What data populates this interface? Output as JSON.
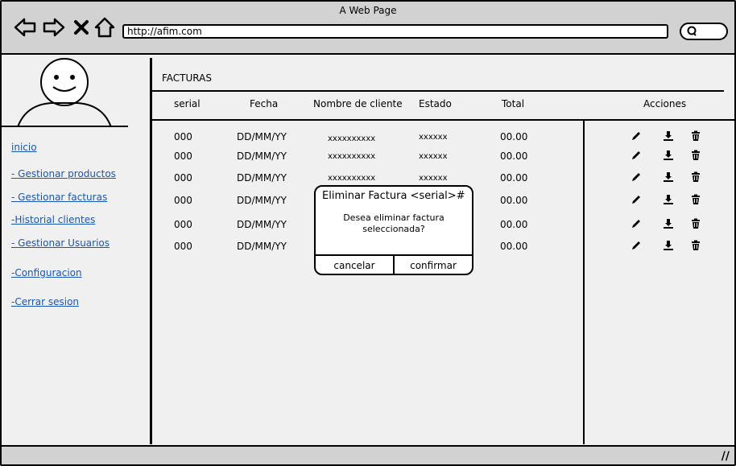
{
  "window": {
    "title": "A Web Page"
  },
  "toolbar": {
    "url": "http://afim.com",
    "resize_glyph": "//"
  },
  "icons": [
    "back-icon",
    "forward-icon",
    "close-icon",
    "home-icon",
    "search-icon",
    "edit-icon",
    "download-icon",
    "delete-icon"
  ],
  "sidebar": {
    "items": [
      {
        "label": "inicio "
      },
      {
        "label": "- Gestionar productos"
      },
      {
        "label": "- Gestionar facturas"
      },
      {
        "label": "-Historial clientes"
      },
      {
        "label": "- Gestionar Usuarios"
      },
      {
        "label": "-Configuracion "
      },
      {
        "label": "-Cerrar sesion"
      }
    ]
  },
  "main": {
    "section_title": "FACTURAS",
    "columns": [
      "serial",
      "Fecha",
      "Nombre de cliente",
      "Estado",
      "Total",
      "Acciones"
    ],
    "rows": [
      {
        "serial": "000",
        "fecha": "DD/MM/YY",
        "cliente": "xxxxxxxxxx",
        "estado": "xxxxxx",
        "total": "00.00"
      },
      {
        "serial": "000",
        "fecha": "DD/MM/YY",
        "cliente": "xxxxxxxxxx",
        "estado": "xxxxxx",
        "total": "00.00"
      },
      {
        "serial": "000",
        "fecha": "DD/MM/YY",
        "cliente": "xxxxxxxxxx",
        "estado": "xxxxxx",
        "total": "00.00"
      },
      {
        "serial": "000",
        "fecha": "DD/MM/YY",
        "cliente": "",
        "estado": "",
        "total": "00.00"
      },
      {
        "serial": "000",
        "fecha": "DD/MM/YY",
        "cliente": "",
        "estado": "",
        "total": "00.00"
      },
      {
        "serial": "000",
        "fecha": "DD/MM/YY",
        "cliente": "",
        "estado": "",
        "total": "00.00"
      }
    ]
  },
  "modal": {
    "title": "Eliminar Factura <serial>#",
    "message": "Desea eliminar factura seleccionada?",
    "cancel_label": "cancelar",
    "confirm_label": "confirmar"
  }
}
